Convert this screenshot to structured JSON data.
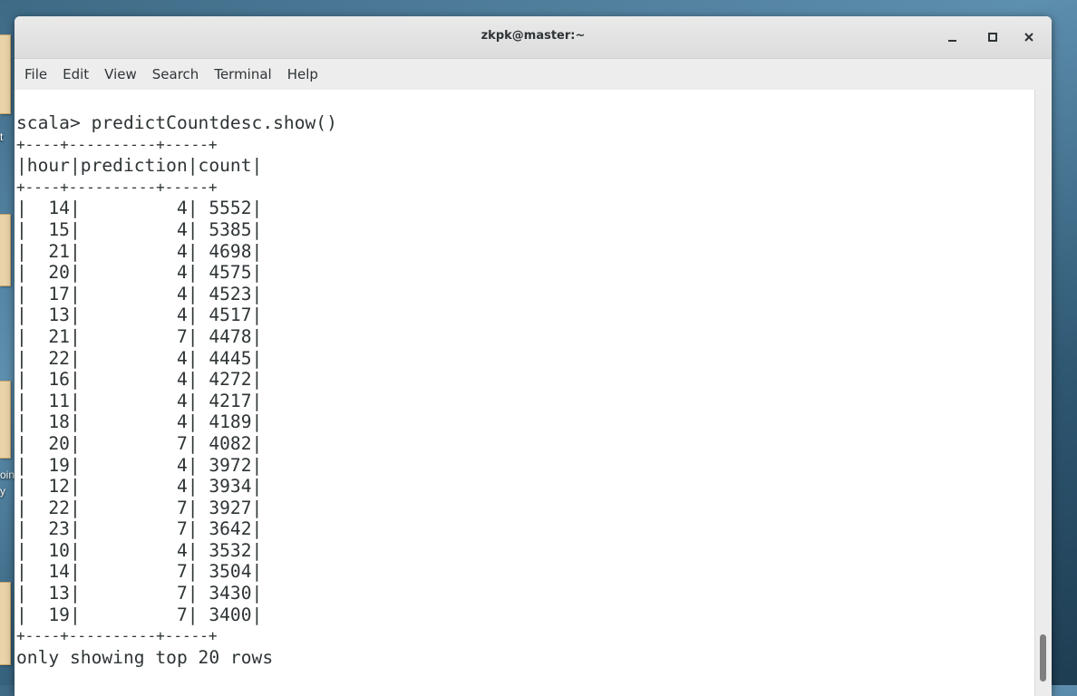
{
  "window": {
    "title": "zkpk@master:~",
    "controls": {
      "minimize": "_",
      "maximize": "□",
      "close": "×"
    }
  },
  "menubar": {
    "items": [
      "File",
      "Edit",
      "View",
      "Search",
      "Terminal",
      "Help"
    ]
  },
  "desktop": {
    "labels": [
      "t",
      "oin",
      "y"
    ]
  },
  "terminal": {
    "lines": [
      {
        "text": "scala> predictCountdesc.show()",
        "kind": "command"
      },
      {
        "text": "+----+----------+-----+",
        "kind": "border"
      },
      {
        "text": "|hour|prediction|count|",
        "kind": "header"
      },
      {
        "text": "+----+----------+-----+",
        "kind": "border"
      },
      {
        "text": "|  14|         4| 5552|",
        "kind": "row"
      },
      {
        "text": "|  15|         4| 5385|",
        "kind": "row"
      },
      {
        "text": "|  21|         4| 4698|",
        "kind": "row"
      },
      {
        "text": "|  20|         4| 4575|",
        "kind": "row"
      },
      {
        "text": "|  17|         4| 4523|",
        "kind": "row"
      },
      {
        "text": "|  13|         4| 4517|",
        "kind": "row"
      },
      {
        "text": "|  21|         7| 4478|",
        "kind": "row"
      },
      {
        "text": "|  22|         4| 4445|",
        "kind": "row"
      },
      {
        "text": "|  16|         4| 4272|",
        "kind": "row"
      },
      {
        "text": "|  11|         4| 4217|",
        "kind": "row"
      },
      {
        "text": "|  18|         4| 4189|",
        "kind": "row"
      },
      {
        "text": "|  20|         7| 4082|",
        "kind": "row"
      },
      {
        "text": "|  19|         4| 3972|",
        "kind": "row"
      },
      {
        "text": "|  12|         4| 3934|",
        "kind": "row"
      },
      {
        "text": "|  22|         7| 3927|",
        "kind": "row"
      },
      {
        "text": "|  23|         7| 3642|",
        "kind": "row"
      },
      {
        "text": "|  10|         4| 3532|",
        "kind": "row"
      },
      {
        "text": "|  14|         7| 3504|",
        "kind": "row"
      },
      {
        "text": "|  13|         7| 3430|",
        "kind": "row"
      },
      {
        "text": "|  19|         7| 3400|",
        "kind": "row"
      },
      {
        "text": "+----+----------+-----+",
        "kind": "border"
      },
      {
        "text": "only showing top 20 rows",
        "kind": "footer"
      }
    ]
  },
  "colors": {
    "terminal_bg": "#ffffff",
    "terminal_fg": "#2e3436",
    "titlebar_bg": "#e4e4e4",
    "menubar_bg": "#ededed"
  }
}
